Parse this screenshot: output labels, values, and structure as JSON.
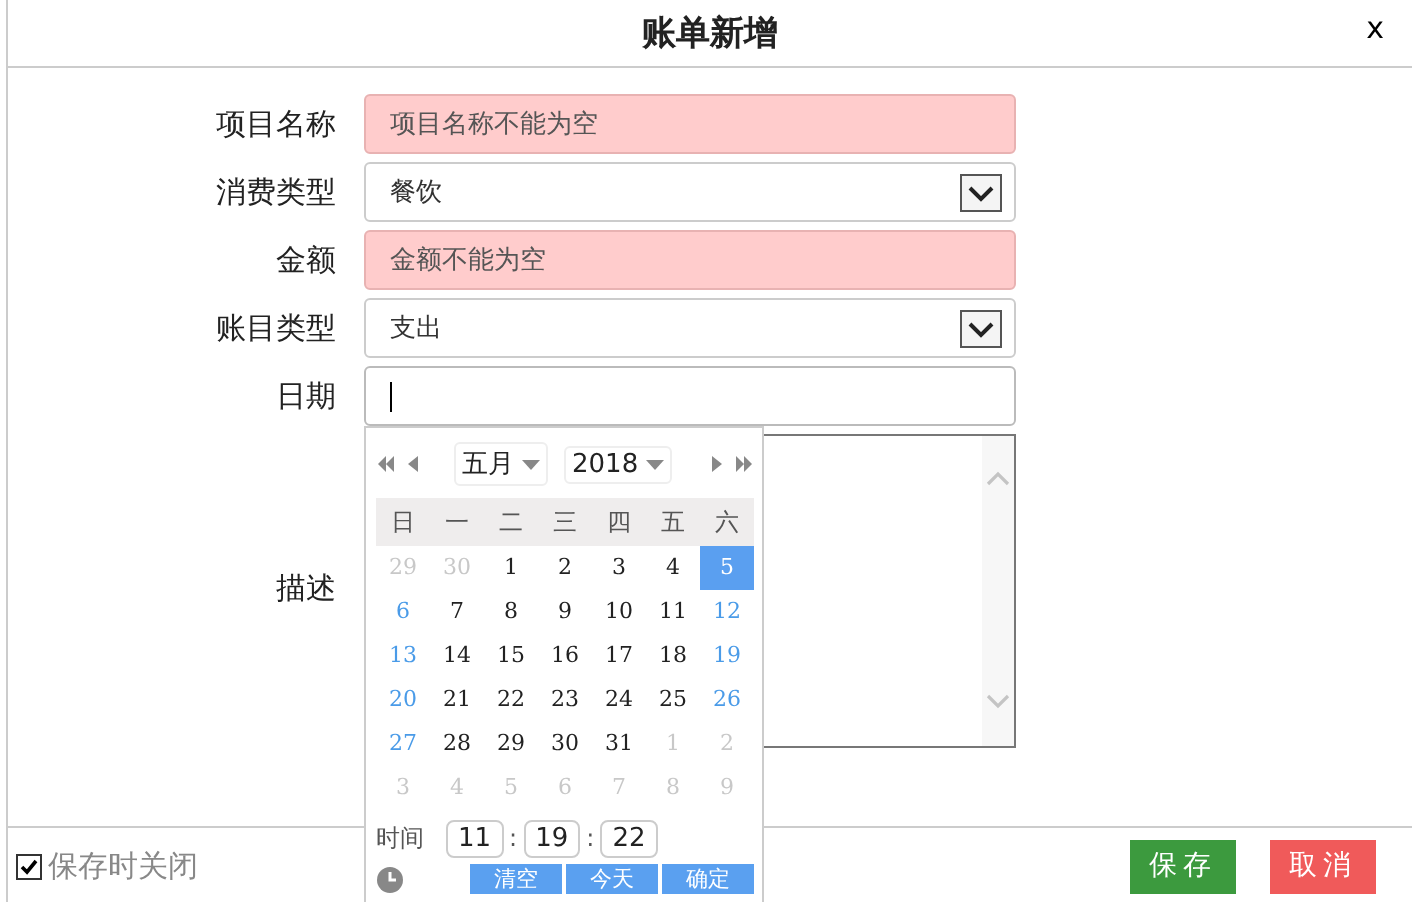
{
  "dialog": {
    "title": "账单新增",
    "close": "x"
  },
  "form": {
    "fields": [
      {
        "label": "项目名称",
        "kind": "text",
        "placeholder": "项目名称不能为空",
        "invalid": true
      },
      {
        "label": "消费类型",
        "kind": "select",
        "value": "餐饮"
      },
      {
        "label": "金额",
        "kind": "text",
        "placeholder": "金额不能为空",
        "invalid": true
      },
      {
        "label": "账目类型",
        "kind": "select",
        "value": "支出"
      },
      {
        "label": "日期",
        "kind": "date",
        "focused": true
      },
      {
        "label": "描述",
        "kind": "textarea"
      }
    ]
  },
  "datepicker": {
    "month": "五月",
    "year": "2018",
    "weekdays": [
      "日",
      "一",
      "二",
      "三",
      "四",
      "五",
      "六"
    ],
    "days": [
      {
        "text": "29",
        "kind": "other",
        "selected": false
      },
      {
        "text": "30",
        "kind": "other",
        "selected": false
      },
      {
        "text": "1",
        "kind": "normal",
        "selected": false
      },
      {
        "text": "2",
        "kind": "normal",
        "selected": false
      },
      {
        "text": "3",
        "kind": "normal",
        "selected": false
      },
      {
        "text": "4",
        "kind": "normal",
        "selected": false
      },
      {
        "text": "5",
        "kind": "weekend",
        "selected": true
      },
      {
        "text": "6",
        "kind": "weekend",
        "selected": false
      },
      {
        "text": "7",
        "kind": "normal",
        "selected": false
      },
      {
        "text": "8",
        "kind": "normal",
        "selected": false
      },
      {
        "text": "9",
        "kind": "normal",
        "selected": false
      },
      {
        "text": "10",
        "kind": "normal",
        "selected": false
      },
      {
        "text": "11",
        "kind": "normal",
        "selected": false
      },
      {
        "text": "12",
        "kind": "weekend",
        "selected": false
      },
      {
        "text": "13",
        "kind": "weekend",
        "selected": false
      },
      {
        "text": "14",
        "kind": "normal",
        "selected": false
      },
      {
        "text": "15",
        "kind": "normal",
        "selected": false
      },
      {
        "text": "16",
        "kind": "normal",
        "selected": false
      },
      {
        "text": "17",
        "kind": "normal",
        "selected": false
      },
      {
        "text": "18",
        "kind": "normal",
        "selected": false
      },
      {
        "text": "19",
        "kind": "weekend",
        "selected": false
      },
      {
        "text": "20",
        "kind": "weekend",
        "selected": false
      },
      {
        "text": "21",
        "kind": "normal",
        "selected": false
      },
      {
        "text": "22",
        "kind": "normal",
        "selected": false
      },
      {
        "text": "23",
        "kind": "normal",
        "selected": false
      },
      {
        "text": "24",
        "kind": "normal",
        "selected": false
      },
      {
        "text": "25",
        "kind": "normal",
        "selected": false
      },
      {
        "text": "26",
        "kind": "weekend",
        "selected": false
      },
      {
        "text": "27",
        "kind": "weekend",
        "selected": false
      },
      {
        "text": "28",
        "kind": "normal",
        "selected": false
      },
      {
        "text": "29",
        "kind": "normal",
        "selected": false
      },
      {
        "text": "30",
        "kind": "normal",
        "selected": false
      },
      {
        "text": "31",
        "kind": "normal",
        "selected": false
      },
      {
        "text": "1",
        "kind": "other",
        "selected": false
      },
      {
        "text": "2",
        "kind": "other",
        "selected": false
      },
      {
        "text": "3",
        "kind": "other",
        "selected": false
      },
      {
        "text": "4",
        "kind": "other",
        "selected": false
      },
      {
        "text": "5",
        "kind": "other",
        "selected": false
      },
      {
        "text": "6",
        "kind": "other",
        "selected": false
      },
      {
        "text": "7",
        "kind": "other",
        "selected": false
      },
      {
        "text": "8",
        "kind": "other",
        "selected": false
      },
      {
        "text": "9",
        "kind": "other",
        "selected": false
      }
    ],
    "time": {
      "label": "时间",
      "hour": "11",
      "minute": "19",
      "second": "22",
      "separator": ":"
    },
    "buttons": [
      "清空",
      "今天",
      "确定"
    ]
  },
  "footer": {
    "close_on_save": {
      "label": "保存时关闭",
      "checked": true
    },
    "buttons": [
      {
        "label": "保存",
        "kind": "primary"
      },
      {
        "label": "取消",
        "kind": "danger"
      }
    ]
  }
}
